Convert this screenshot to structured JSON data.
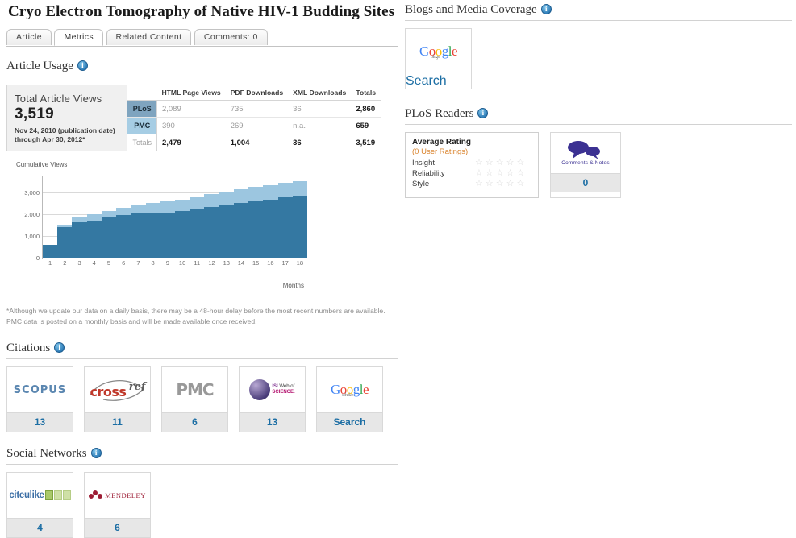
{
  "article": {
    "title": "Cryo Electron Tomography of Native HIV-1 Budding Sites"
  },
  "tabs": [
    {
      "label": "Article",
      "active": false
    },
    {
      "label": "Metrics",
      "active": true
    },
    {
      "label": "Related Content",
      "active": false
    },
    {
      "label": "Comments: 0",
      "active": false
    }
  ],
  "sections": {
    "article_usage": "Article Usage",
    "citations": "Citations",
    "social_networks": "Social Networks",
    "blogs_media": "Blogs and Media Coverage",
    "plos_readers": "PLoS Readers",
    "info_glyph": "i"
  },
  "usage": {
    "total_label": "Total Article Views",
    "total_value": "3,519",
    "date_line1": "Nov 24, 2010 (publication date)",
    "date_line2": "through Apr 30, 2012*",
    "columns": [
      "",
      "HTML Page Views",
      "PDF Downloads",
      "XML Downloads",
      "Totals"
    ],
    "rows": [
      {
        "name": "PLoS",
        "html": "2,089",
        "pdf": "735",
        "xml": "36",
        "totals": "2,860"
      },
      {
        "name": "PMC",
        "html": "390",
        "pdf": "269",
        "xml": "n.a.",
        "totals": "659"
      },
      {
        "name": "Totals",
        "html": "2,479",
        "pdf": "1,004",
        "xml": "36",
        "totals": "3,519"
      }
    ],
    "footnote": "*Although we update our data on a daily basis, there may be a 48-hour delay before the most recent numbers are available. PMC data is posted on a monthly basis and will be made available once received."
  },
  "chart_data": {
    "type": "bar",
    "stacked": true,
    "title": "",
    "ylabel": "Cumulative Views",
    "xlabel": "Months",
    "categories": [
      "1",
      "2",
      "3",
      "4",
      "5",
      "6",
      "7",
      "8",
      "9",
      "10",
      "11",
      "12",
      "13",
      "14",
      "15",
      "16",
      "17",
      "18"
    ],
    "yticks": [
      "0",
      "1,000",
      "2,000",
      "3,000"
    ],
    "ylim": [
      0,
      3700
    ],
    "grid": true,
    "legend": "none",
    "series": [
      {
        "name": "PLoS",
        "color": "#3478a2",
        "values": [
          600,
          1400,
          1620,
          1710,
          1840,
          1950,
          2020,
          2070,
          2090,
          2140,
          2240,
          2340,
          2420,
          2510,
          2590,
          2680,
          2790,
          2860
        ]
      },
      {
        "name": "PMC",
        "color": "#9cc6e0",
        "values": [
          0,
          130,
          240,
          290,
          300,
          360,
          420,
          450,
          490,
          530,
          570,
          590,
          610,
          620,
          650,
          660,
          670,
          660
        ]
      }
    ],
    "totals": [
      600,
      1530,
      1860,
      2000,
      2140,
      2310,
      2440,
      2520,
      2580,
      2670,
      2810,
      2930,
      3030,
      3130,
      3240,
      3340,
      3460,
      3520
    ]
  },
  "citations": [
    {
      "source": "scopus",
      "logo_text": "SCOPUS",
      "value": "13"
    },
    {
      "source": "crossref",
      "logo_text": "crossref",
      "value": "11"
    },
    {
      "source": "pmc",
      "logo_text": "PMC",
      "value": "6"
    },
    {
      "source": "isi-web-of-science",
      "logo_text": "ISI Web of SCIENCE.",
      "value": "13"
    },
    {
      "source": "google-scholar",
      "logo_text": "Google scholar",
      "value": "Search"
    }
  ],
  "social_networks": [
    {
      "source": "citeulike",
      "logo_text": "citeulike",
      "value": "4"
    },
    {
      "source": "mendeley",
      "logo_text": "MENDELEY",
      "value": "6"
    }
  ],
  "blogs": [
    {
      "source": "google-blogs",
      "logo_text": "Google blogs",
      "value": "Search"
    }
  ],
  "readers": {
    "rating_title": "Average Rating",
    "rating_link": "(0 User Ratings)",
    "criteria": [
      {
        "label": "Insight",
        "stars": 0
      },
      {
        "label": "Reliability",
        "stars": 0
      },
      {
        "label": "Style",
        "stars": 0
      }
    ],
    "star_glyph": "☆",
    "comments_caption": "Comments & Notes",
    "comments_value": "0"
  }
}
